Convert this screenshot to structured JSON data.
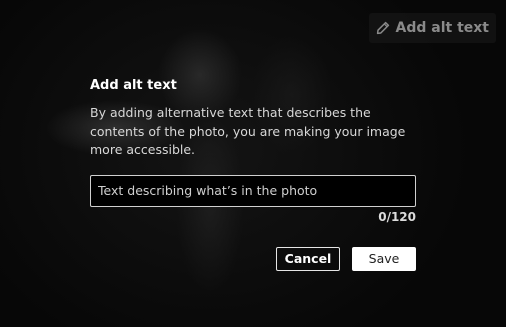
{
  "header": {
    "add_alt_text_button_label": "Add alt text",
    "button_icon": "pencil-icon"
  },
  "dialog": {
    "title": "Add alt text",
    "description": "By adding alternative text that describes the contents of the photo, you are making your image more accessible.",
    "input": {
      "value": "",
      "placeholder": "Text describing what’s in the photo"
    },
    "counter": "0/120",
    "cancel_label": "Cancel",
    "save_label": "Save"
  },
  "colors": {
    "background": "#080808",
    "text": "#ffffff",
    "save_button_bg": "#ffffff"
  }
}
